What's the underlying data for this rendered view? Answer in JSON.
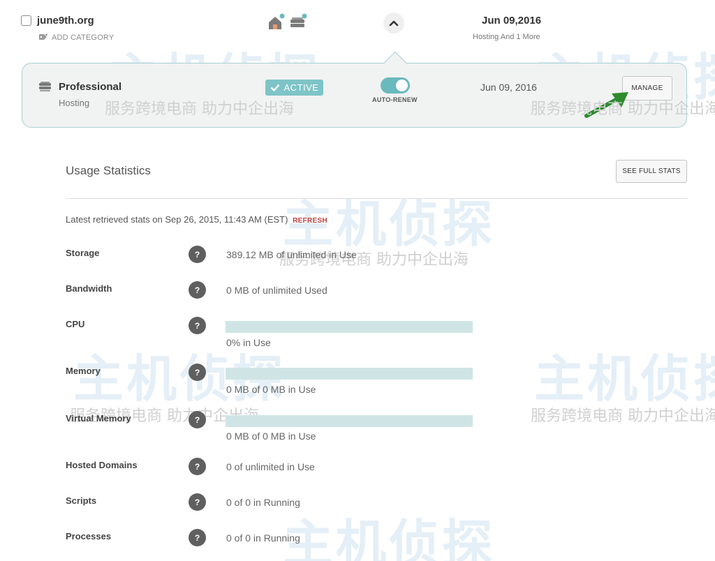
{
  "domain": {
    "name": "june9th.org",
    "add_category": "ADD CATEGORY",
    "expiration_date": "Jun 09,2016",
    "expiration_sub": "Hosting And 1 More"
  },
  "product": {
    "name": "Professional",
    "type": "Hosting",
    "status": "ACTIVE",
    "auto_renew_label": "AUTO-RENEW",
    "auto_renew_on": true,
    "date": "Jun 09, 2016",
    "manage_label": "MANAGE"
  },
  "usage": {
    "title": "Usage Statistics",
    "full_stats_label": "SEE FULL STATS",
    "retrieved_text": "Latest retrieved stats on Sep 26, 2015, 11:43 AM (EST)",
    "refresh_label": "REFRESH",
    "stats": [
      {
        "label": "Storage",
        "value": "389.12 MB of unlimited in Use"
      },
      {
        "label": "Bandwidth",
        "value": "0 MB of unlimited Used"
      },
      {
        "label": "CPU",
        "value": "0% in Use",
        "bar_fraction": 0
      },
      {
        "label": "Memory",
        "value": "0 MB of 0 MB in Use",
        "bar_fraction": 0
      },
      {
        "label": "Virtual Memory",
        "value": "0 MB of 0 MB in Use",
        "bar_fraction": 0
      },
      {
        "label": "Hosted Domains",
        "value": "0 of unlimited in Use"
      },
      {
        "label": "Scripts",
        "value": "0 of 0 in Running"
      },
      {
        "label": "Processes",
        "value": "0 of 0 in Running"
      }
    ]
  },
  "help_glyph": "?",
  "watermark": {
    "logo_text": "主机侦探",
    "tagline": "服务跨境电商 助力中企出海"
  },
  "colors": {
    "teal": "#7ec4c7",
    "toggle": "#6ab9bd",
    "bar_track": "#cfe5e5",
    "refresh": "#c3433f",
    "panel_border": "#a9cfd2",
    "arrow": "#2e8b2e"
  },
  "icons": [
    "tag-icon",
    "home-service-icon",
    "hosting-service-icon",
    "chevron-up-icon",
    "server-icon",
    "check-icon",
    "help-icon"
  ]
}
